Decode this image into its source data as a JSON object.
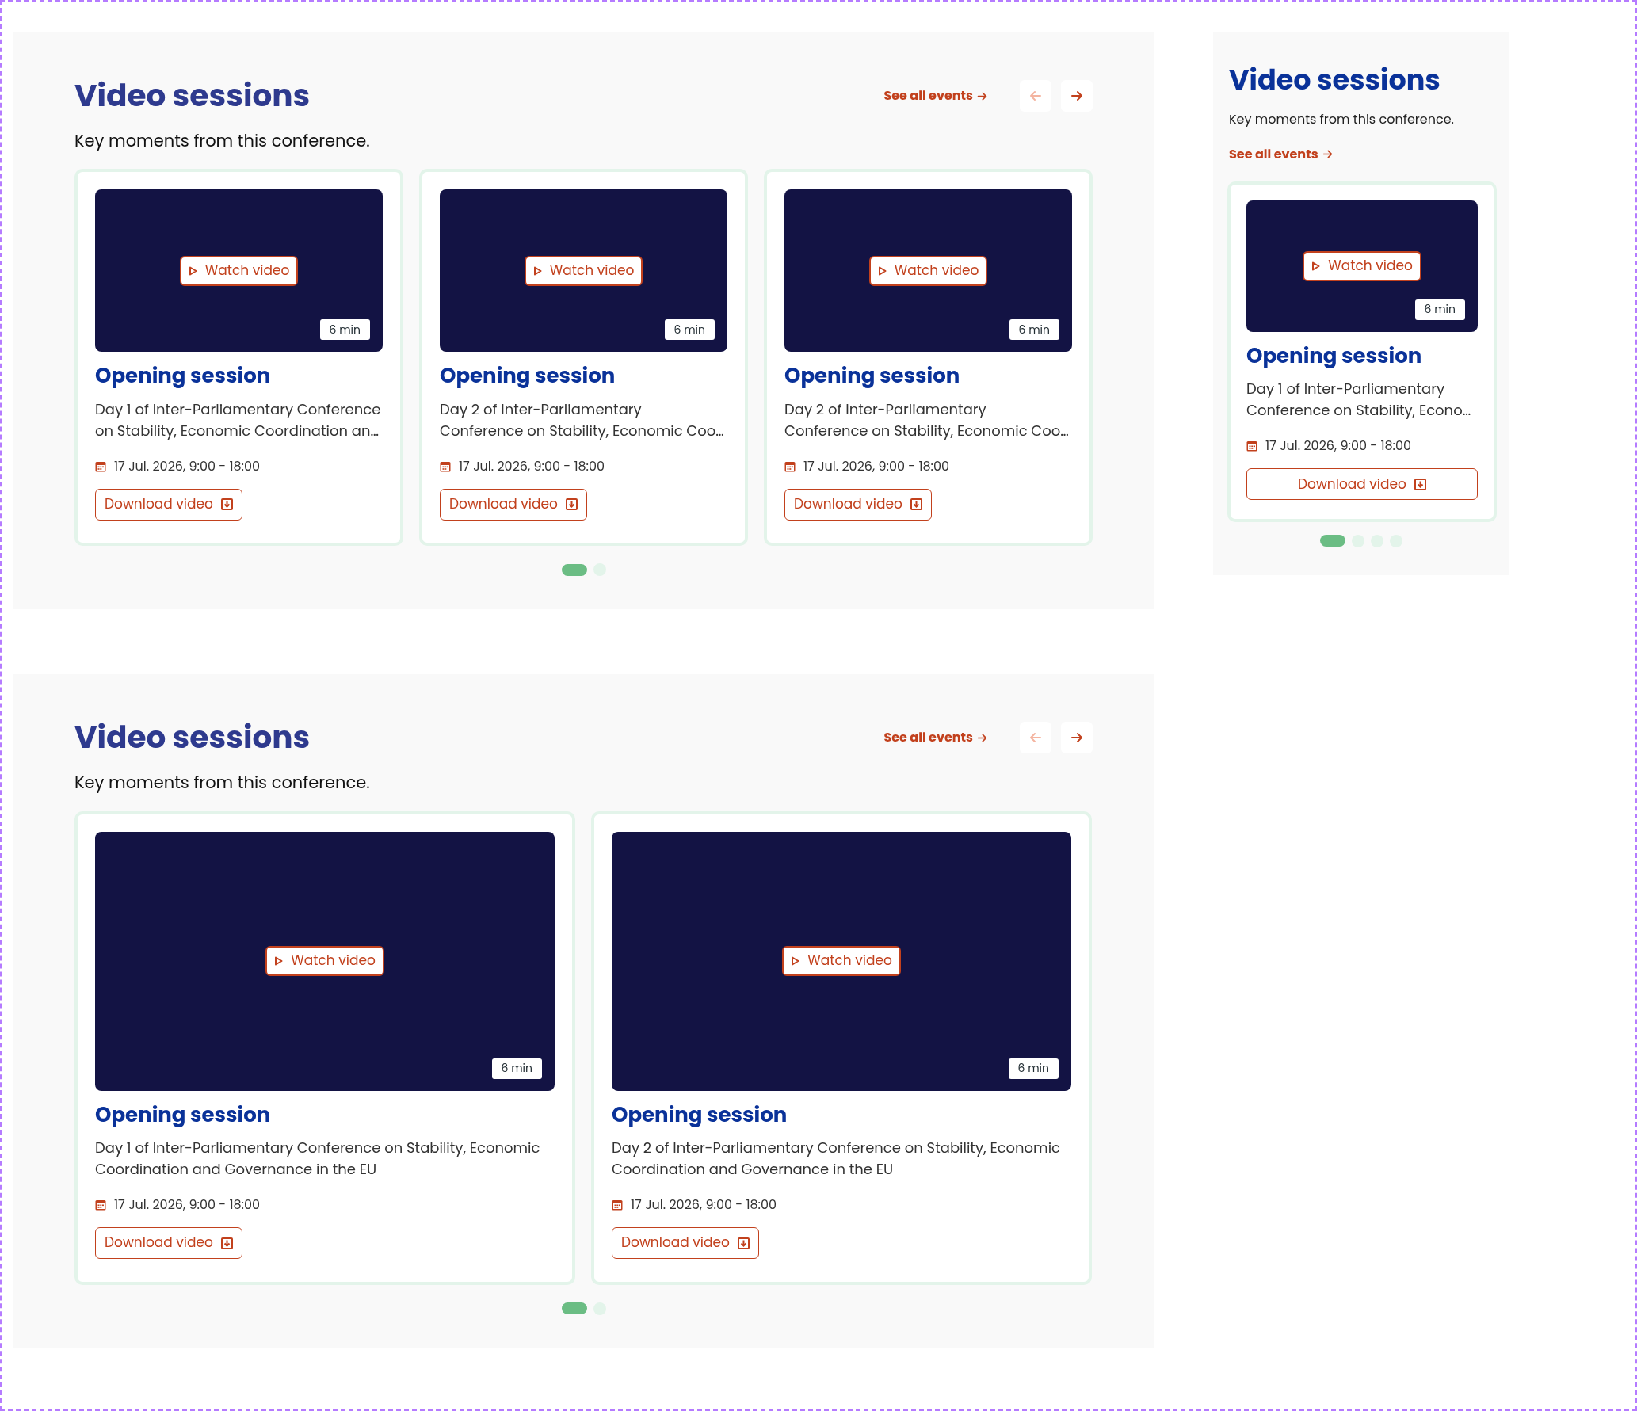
{
  "sections": [
    {
      "kind": "three-up",
      "title": "Video sessions",
      "subtitle": "Key moments from this conference.",
      "see_all": "See all events",
      "arrows": [
        {
          "kind": "prev",
          "disabled": true
        },
        {
          "kind": "next",
          "disabled": false
        }
      ],
      "cards": [
        {
          "duration": "6 min",
          "watch": "Watch video",
          "title": "Opening session",
          "description": "Day 1 of Inter-Parliamentary Conference on Stability, Economic Coordination an…",
          "date": "17 Jul. 2026, 9:00 - 18:00",
          "download": "Download video"
        },
        {
          "duration": "6 min",
          "watch": "Watch video",
          "title": "Opening session",
          "description": "Day 2 of Inter-Parliamentary Conference on Stability, Economic Coo…",
          "date": "17 Jul. 2026, 9:00 - 18:00",
          "download": "Download video"
        },
        {
          "duration": "6 min",
          "watch": "Watch video",
          "title": "Opening session",
          "description": "Day 2 of Inter-Parliamentary Conference on Stability, Economic Coo…",
          "date": "17 Jul. 2026, 9:00 - 18:00",
          "download": "Download video"
        }
      ],
      "dots": [
        {
          "selected": true
        },
        {
          "selected": false
        }
      ]
    },
    {
      "kind": "mobile",
      "title": "Video sessions",
      "subtitle": "Key moments from this conference.",
      "see_all": "See all events",
      "cards": [
        {
          "duration": "6 min",
          "watch": "Watch video",
          "title": "Opening session",
          "description": "Day 1 of Inter-Parliamentary Conference on Stability, Econo…",
          "date": "17 Jul. 2026, 9:00 - 18:00",
          "download": "Download video"
        }
      ],
      "dots": [
        {
          "selected": true
        },
        {
          "selected": false
        },
        {
          "selected": false
        },
        {
          "selected": false
        }
      ]
    },
    {
      "kind": "two-up",
      "title": "Video sessions",
      "subtitle": "Key moments from this conference.",
      "see_all": "See all events",
      "arrows": [
        {
          "kind": "prev",
          "disabled": true
        },
        {
          "kind": "next",
          "disabled": false
        }
      ],
      "cards": [
        {
          "duration": "6 min",
          "watch": "Watch video",
          "title": "Opening session",
          "description": "Day 1 of Inter-Parliamentary Conference on Stability, Economic Coordination and Governance in the EU",
          "date": "17 Jul. 2026, 9:00 - 18:00",
          "download": "Download video"
        },
        {
          "duration": "6 min",
          "watch": "Watch video",
          "title": "Opening session",
          "description": "Day 2 of Inter-Parliamentary Conference on Stability, Economic Coordination and Governance in the EU",
          "date": "17 Jul. 2026, 9:00 - 18:00",
          "download": "Download video"
        }
      ],
      "dots": [
        {
          "selected": true
        },
        {
          "selected": false
        }
      ]
    }
  ]
}
